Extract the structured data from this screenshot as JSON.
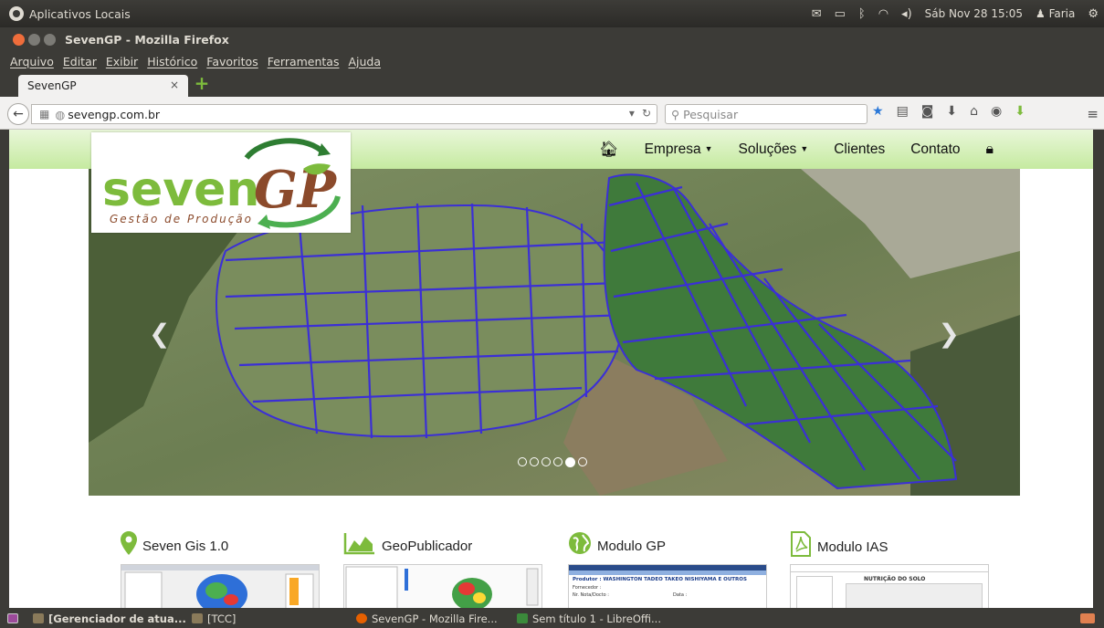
{
  "panel": {
    "app_name": "Aplicativos Locais",
    "clock": "Sáb Nov 28 15:05",
    "user": "Faria"
  },
  "window": {
    "title": "SevenGP - Mozilla Firefox"
  },
  "menu": {
    "items": [
      "Arquivo",
      "Editar",
      "Exibir",
      "Histórico",
      "Favoritos",
      "Ferramentas",
      "Ajuda"
    ]
  },
  "tab": {
    "label": "SevenGP",
    "close": "×"
  },
  "nav": {
    "url": "sevengp.com.br",
    "search_placeholder": "Pesquisar"
  },
  "site": {
    "menu": {
      "empresa": "Empresa",
      "solucoes": "Soluções",
      "clientes": "Clientes",
      "contato": "Contato"
    },
    "logo": {
      "seven": "seven",
      "gp": "GP",
      "tagline": "Gestão de Produção"
    },
    "carousel": {
      "slides": 6,
      "active_index": 4
    },
    "products": [
      {
        "label": "Seven Gis 1.0",
        "icon": "map-pin-icon"
      },
      {
        "label": "GeoPublicador",
        "icon": "area-chart-icon"
      },
      {
        "label": "Modulo GP",
        "icon": "globe-icon"
      },
      {
        "label": "Modulo IAS",
        "icon": "pdf-icon"
      }
    ],
    "thumb_texts": {
      "gp_producer_label": "Produtor :",
      "gp_producer": "WASHINGTON TADEO TAKEO NISHIYAMA E OUTROS",
      "gp_supplier": "Fornecedor :",
      "gp_invoice": "Nr. Nota/Docto :",
      "gp_date": "Data :",
      "ias_title": "NUTRIÇÃO DO SOLO"
    }
  },
  "taskbar": {
    "items": [
      {
        "label": "[Gerenciador de atua...",
        "bold": true
      },
      {
        "label": "[TCC]",
        "bold": false
      },
      {
        "label": "SevenGP - Mozilla Fire...",
        "bold": false
      },
      {
        "label": "Sem título 1 - LibreOffi...",
        "bold": false
      }
    ]
  },
  "colors": {
    "accent_green": "#7dbb3c",
    "logo_brown": "#8b4a2b",
    "grid_blue": "#3b2fd6"
  }
}
